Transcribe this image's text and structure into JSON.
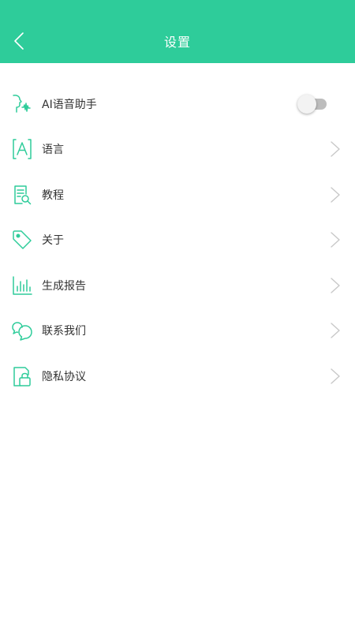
{
  "header": {
    "title": "设置",
    "back_icon": "chevron-left-icon"
  },
  "colors": {
    "accent": "#2ecc9a",
    "text": "#333333",
    "chevron": "#c8c8c8",
    "toggle_track": "#bdbdbd",
    "toggle_knob": "#f3f3f3"
  },
  "settings": {
    "items": [
      {
        "label": "AI语音助手",
        "icon": "voice-assistant-icon",
        "control": "toggle",
        "toggle_on": false
      },
      {
        "label": "语言",
        "icon": "language-icon",
        "control": "chevron"
      },
      {
        "label": "教程",
        "icon": "tutorial-icon",
        "control": "chevron"
      },
      {
        "label": "关于",
        "icon": "tag-icon",
        "control": "chevron"
      },
      {
        "label": "生成报告",
        "icon": "bar-chart-icon",
        "control": "chevron"
      },
      {
        "label": "联系我们",
        "icon": "chat-bubbles-icon",
        "control": "chevron"
      },
      {
        "label": "隐私协议",
        "icon": "privacy-lock-icon",
        "control": "chevron"
      }
    ]
  }
}
